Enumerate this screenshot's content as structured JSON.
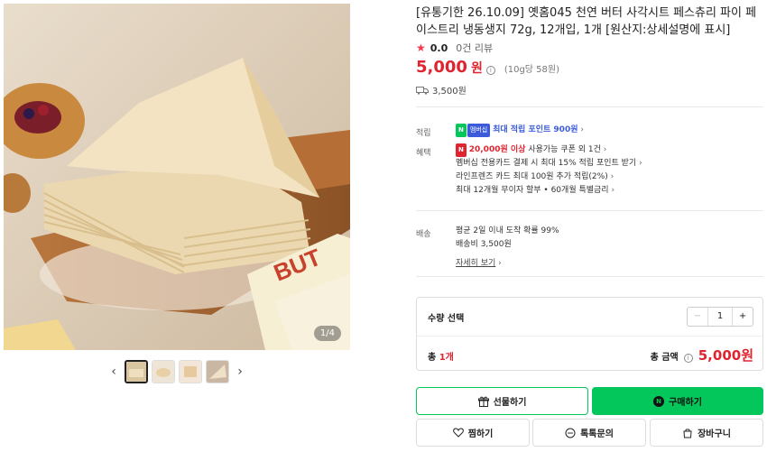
{
  "gallery": {
    "counter": "1/4",
    "prev_arrow": "‹",
    "next_arrow": "›",
    "main_label_text": "BUT"
  },
  "product": {
    "title": "[유통기한 26.10.09] 옛홈045 천연 버터 사각시트 페스츄리 파이 페이스트리 냉동생지 72g, 12개입, 1개 [원산지:상세설명에 표시]",
    "rating": "0.0",
    "reviews": "0건 리뷰",
    "price": "5,000",
    "won": "원",
    "unit_price": "(10g당 58원)",
    "shipping_fee": "3,500원"
  },
  "benefits": {
    "points_label": "적립",
    "points_badge_n": "N",
    "points_badge_m": "멤버십",
    "points_text": "최대 적립 포인트 900원",
    "benefit_label": "혜택",
    "coupon_badge": "N",
    "coupon_highlight": "20,000원 이상",
    "coupon_rest": "사용가능 쿠폰 외 1건",
    "line2": "멤버십 전용카드 결제 시 최대 15% 적립 포인트 받기",
    "line3": "라인프렌즈 카드 최대 100원 추가 적립(2%)",
    "line4": "최대 12개월 무이자 할부 • 60개월 특별금리"
  },
  "delivery": {
    "label": "배송",
    "line1": "평균 2일 이내 도착 확률 99%",
    "line2": "배송비 3,500원",
    "more": "자세히 보기"
  },
  "quantity": {
    "header": "수량 선택",
    "minus": "−",
    "value": "1",
    "plus": "+",
    "total_prefix": "총",
    "total_count": "1개",
    "total_label": "총 금액",
    "total_value": "5,000원"
  },
  "buttons": {
    "gift": "선물하기",
    "buy": "구매하기",
    "wish": "찜하기",
    "talk": "톡톡문의",
    "cart": "장바구니"
  },
  "colors": {
    "accent_red": "#e0242f",
    "naver_green": "#03c75a",
    "blue": "#3b5bdb"
  }
}
